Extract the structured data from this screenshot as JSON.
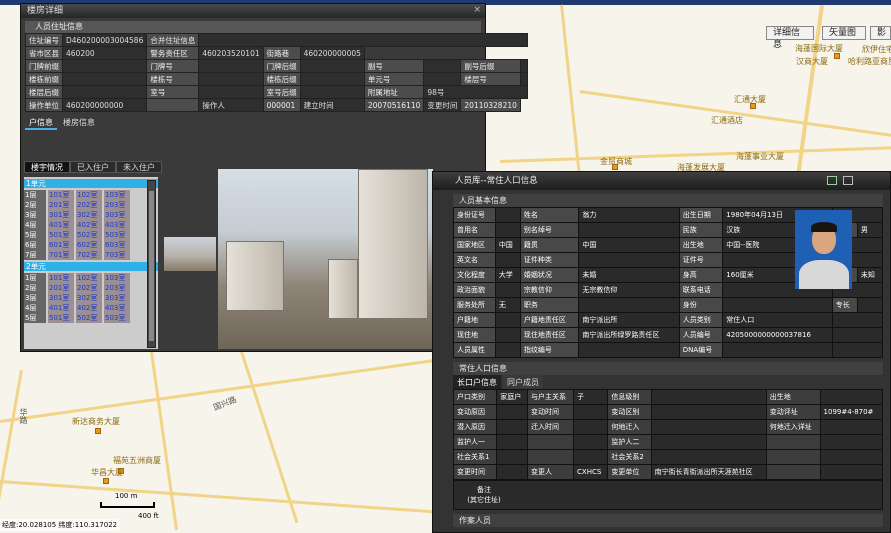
{
  "map": {
    "top_labels": [
      "",
      ""
    ],
    "tools": [
      "详细信息",
      "矢量图",
      "影"
    ],
    "pois": [
      {
        "name": "海蓬国际大厦"
      },
      {
        "name": "汉商大厦"
      },
      {
        "name": "欣伊住宅"
      },
      {
        "name": "哈利路亚商贸"
      },
      {
        "name": "汇通大厦"
      },
      {
        "name": "汇通酒店"
      },
      {
        "name": "金贸商城"
      },
      {
        "name": "海蓬发展大厦"
      },
      {
        "name": "海蓬事业大厦"
      },
      {
        "name": "新达商务大厦"
      },
      {
        "name": "福苑五洲商厦"
      },
      {
        "name": "华昌大厦"
      }
    ],
    "road_labels": [
      "国兴路",
      "华路"
    ],
    "scale_m": "100 m",
    "scale_ft": "400 ft",
    "coord_text": "经度:20.028105  纬度:110.317022"
  },
  "win1": {
    "title": "楼房详细",
    "close": "×",
    "section": "人员住址信息",
    "rows": [
      [
        "住址编号",
        "D460200003004586",
        "合并住址信息",
        ""
      ],
      [
        "省市区县",
        "460200",
        "警务责任区",
        "460203520101",
        "街路巷",
        "460200000005"
      ],
      [
        "门牌前缀",
        "",
        "门牌号",
        "",
        "门牌后缀",
        "",
        "副号",
        "",
        "副号后缀",
        ""
      ],
      [
        "楼栋前缀",
        "",
        "楼栋号",
        "",
        "楼栋后缀",
        "",
        "单元号",
        "",
        "楼层号",
        ""
      ],
      [
        "楼层后缀",
        "",
        "室号",
        "",
        "室号后缀",
        "",
        "附属地址",
        "98号"
      ],
      [
        "操作单位",
        "460200000000",
        "",
        "操作人",
        "000001",
        "建立时间",
        "20070516110",
        "变更时间",
        "20110328210"
      ]
    ],
    "tabs": [
      "户信息",
      "楼房信息"
    ],
    "subtabs": [
      "楼宇情况",
      "已入住户",
      "未入住户"
    ],
    "units": [
      {
        "name": "1单元",
        "floors": [
          {
            "f": "1层",
            "rooms": [
              "101室",
              "102室",
              "103室"
            ]
          },
          {
            "f": "2层",
            "rooms": [
              "201室",
              "202室",
              "203室"
            ]
          },
          {
            "f": "3层",
            "rooms": [
              "301室",
              "302室",
              "303室"
            ]
          },
          {
            "f": "4层",
            "rooms": [
              "401室",
              "402室",
              "403室"
            ]
          },
          {
            "f": "5层",
            "rooms": [
              "501室",
              "502室",
              "503室"
            ]
          },
          {
            "f": "6层",
            "rooms": [
              "601室",
              "602室",
              "603室"
            ]
          },
          {
            "f": "7层",
            "rooms": [
              "701室",
              "702室",
              "703室"
            ]
          }
        ]
      },
      {
        "name": "2单元",
        "floors": [
          {
            "f": "1层",
            "rooms": [
              "101室",
              "102室",
              "103室"
            ]
          },
          {
            "f": "2层",
            "rooms": [
              "201室",
              "202室",
              "203室"
            ]
          },
          {
            "f": "3层",
            "rooms": [
              "301室",
              "302室",
              "303室"
            ]
          },
          {
            "f": "4层",
            "rooms": [
              "401室",
              "402室",
              "403室"
            ]
          },
          {
            "f": "5层",
            "rooms": [
              "501室",
              "502室",
              "503室"
            ]
          }
        ]
      }
    ]
  },
  "win2": {
    "title": "人员库--常住人口信息",
    "section1": "人员基本信息",
    "basic": [
      [
        "身份证号",
        "",
        "姓名",
        "翁力",
        "出生日期",
        "1980年04月13日"
      ],
      [
        "曾用名",
        "",
        "别名绰号",
        "",
        "民族",
        "汉族",
        "性别",
        "男"
      ],
      [
        "国家地区",
        "中国",
        "籍贯",
        "中国",
        "出生地",
        "中国--医院"
      ],
      [
        "英文名",
        "",
        "证件种类",
        "",
        "证件号",
        ""
      ],
      [
        "文化程度",
        "大学",
        "婚姻状况",
        "未婚",
        "身高",
        "160厘米",
        "血型",
        "未知"
      ],
      [
        "政治面貌",
        "",
        "宗教信仰",
        "无宗教信仰",
        "联系电话",
        ""
      ],
      [
        "服务处所",
        "无",
        "职务",
        "",
        "身份",
        "",
        "专长",
        ""
      ],
      [
        "户籍地",
        "",
        "户籍地责任区",
        "南宁派出所",
        "人员类别",
        "常住人口"
      ],
      [
        "现住地",
        "",
        "现住地责任区",
        "南宁派出所绿罗路责任区",
        "人员编号",
        "4205000000000037816"
      ],
      [
        "人员属性",
        "",
        "指纹编号",
        "",
        "DNA编号",
        ""
      ]
    ],
    "section2": "常住人口信息",
    "tabs": [
      "长口户信息",
      "同户成员"
    ],
    "res": [
      [
        "户口类别",
        "家庭户",
        "与户主关系",
        "子",
        "信息级别",
        "",
        "出生地",
        ""
      ],
      [
        "变动原因",
        "",
        "变动时间",
        "",
        "变动区别",
        "",
        "变动评址",
        "1099#4-870#"
      ],
      [
        "潜入原因",
        "",
        "迁入时间",
        "",
        "何地迁入",
        "",
        "何地迁入详址",
        ""
      ],
      [
        "监护人一",
        "",
        "",
        "",
        "监护人二",
        "",
        "",
        ""
      ],
      [
        "社会关系1",
        "",
        "",
        "",
        "社会关系2",
        "",
        "",
        ""
      ],
      [
        "变更时间",
        "",
        "变更人",
        "CXHCS",
        "变更单位",
        "南宁街长青街派出所天涯苑社区",
        "",
        ""
      ]
    ],
    "remark_label": "备注\n(其它住址)",
    "section3": "作案人员"
  }
}
